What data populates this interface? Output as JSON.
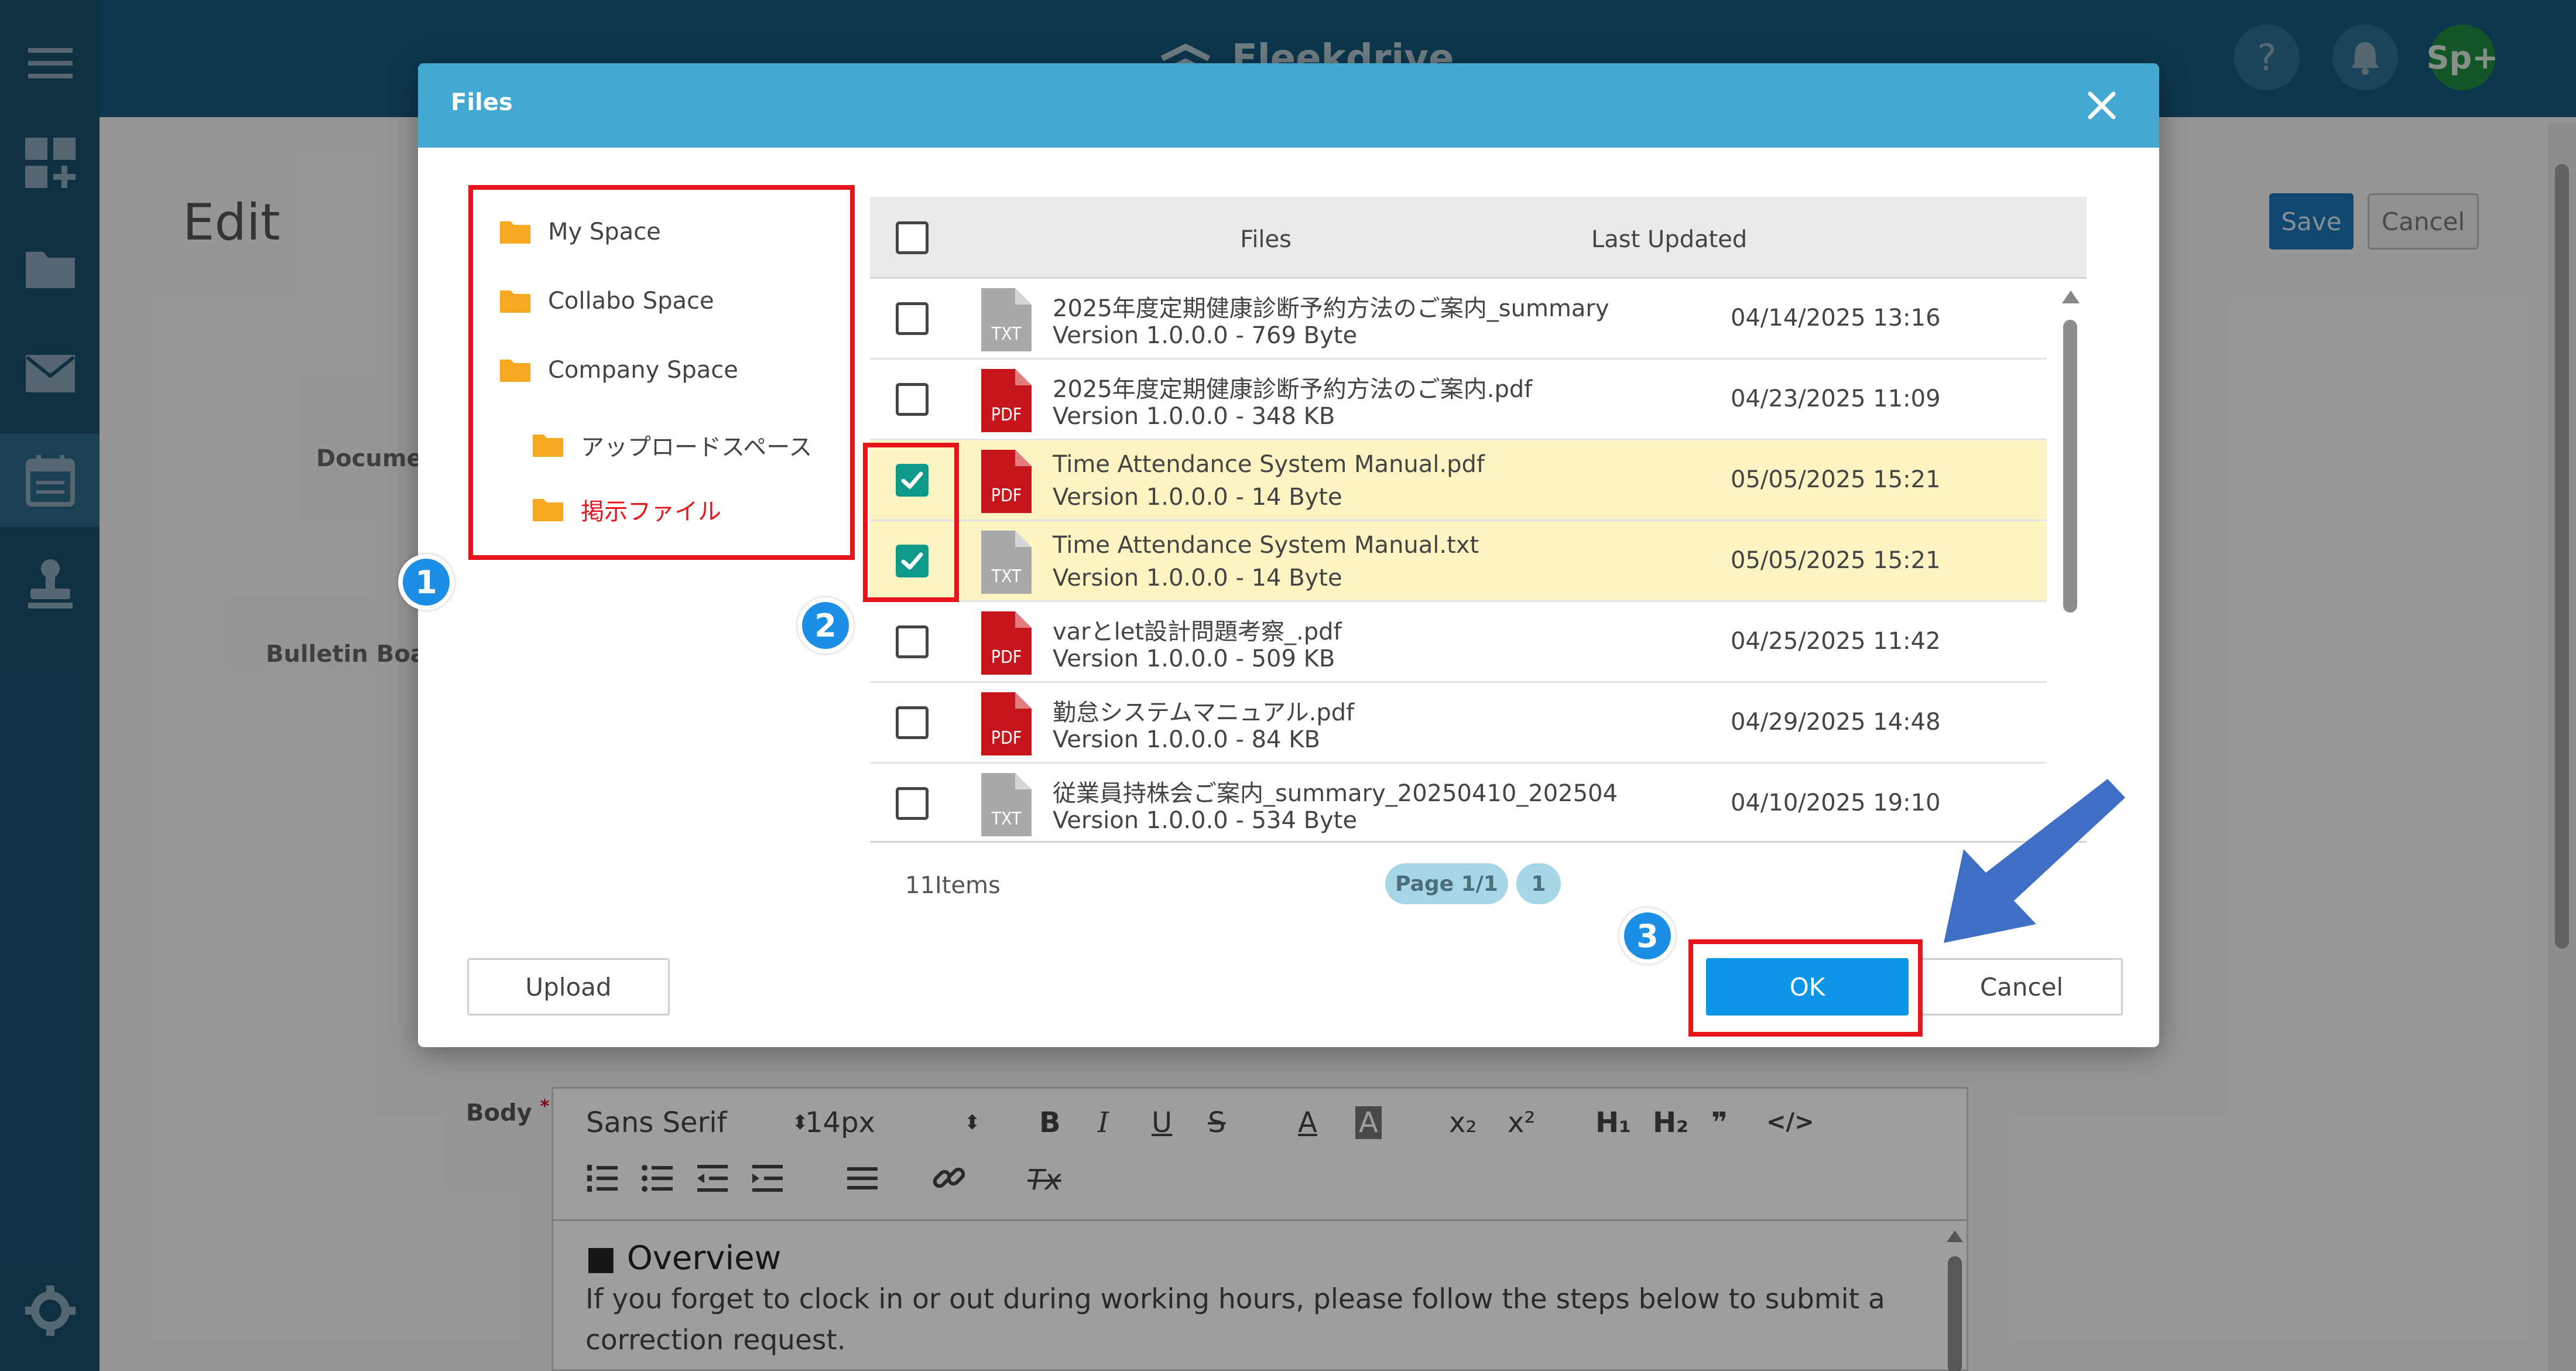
{
  "app": {
    "logo_text": "Fleekdrive",
    "help_glyph": "?",
    "avatar_text": "Sp+",
    "page_title": "Edit",
    "save_label": "Save",
    "cancel_label": "Cancel",
    "label_document": "Document",
    "label_bulletin": "Bulletin Board",
    "sidebar_icons": [
      "menu-icon",
      "dashboard-add-icon",
      "folder-icon",
      "mail-icon",
      "calendar-icon",
      "stamp-icon",
      "gear-icon"
    ]
  },
  "editor": {
    "body_label": "Body",
    "required_mark": "*",
    "font_family": "Sans Serif",
    "font_size": "14px",
    "toolbar_row1": [
      "B",
      "I",
      "U",
      "S",
      "A",
      "A",
      "x₂",
      "x²",
      "H₁",
      "H₂",
      "❞",
      "</>"
    ],
    "toolbar_row2": [
      "list-ordered-icon",
      "list-bullet-icon",
      "outdent-icon",
      "indent-icon",
      "align-icon",
      "link-icon",
      "clear-format-icon"
    ],
    "clear_format_glyph": "Tx",
    "content_heading": "■ Overview",
    "content_text": "If you forget to clock in or out during working hours, please follow the steps below to submit a correction request."
  },
  "dialog": {
    "title": "Files",
    "folders": [
      {
        "name": "My Space",
        "active": false
      },
      {
        "name": "Collabo Space",
        "active": false
      },
      {
        "name": "Company Space",
        "active": false
      },
      {
        "name": "アップロードスペース",
        "active": false
      },
      {
        "name": "掲示ファイル",
        "active": true
      }
    ],
    "table": {
      "col_files": "Files",
      "col_updated": "Last Updated",
      "rows": [
        {
          "type": "TXT",
          "name": "2025年度定期健康診断予約方法のご案内_summary",
          "version": "Version 1.0.0.0 - 769 Byte",
          "updated": "04/14/2025 13:16",
          "checked": false
        },
        {
          "type": "PDF",
          "name": "2025年度定期健康診断予約方法のご案内.pdf",
          "version": "Version 1.0.0.0 - 348 KB",
          "updated": "04/23/2025 11:09",
          "checked": false
        },
        {
          "type": "PDF",
          "name": "Time Attendance System Manual.pdf",
          "version": "Version 1.0.0.0 - 14 Byte",
          "updated": "05/05/2025 15:21",
          "checked": true
        },
        {
          "type": "TXT",
          "name": "Time Attendance System Manual.txt",
          "version": "Version 1.0.0.0 - 14 Byte",
          "updated": "05/05/2025 15:21",
          "checked": true
        },
        {
          "type": "PDF",
          "name": "varとlet設計問題考察_.pdf",
          "version": "Version 1.0.0.0 - 509 KB",
          "updated": "04/25/2025 11:42",
          "checked": false
        },
        {
          "type": "PDF",
          "name": "勤怠システムマニュアル.pdf",
          "version": "Version 1.0.0.0 - 84 KB",
          "updated": "04/29/2025 14:48",
          "checked": false
        },
        {
          "type": "TXT",
          "name": "従業員持株会ご案内_summary_20250410_202504",
          "version": "Version 1.0.0.0 - 534 Byte",
          "updated": "04/10/2025 19:10",
          "checked": false
        }
      ],
      "items_count": "11Items",
      "page_label": "Page 1/1",
      "page_number": "1"
    },
    "upload_label": "Upload",
    "ok_label": "OK",
    "cancel_label": "Cancel"
  },
  "annotations": {
    "step1": "1",
    "step2": "2",
    "step3": "3",
    "highlight_color": "#e8141b",
    "badge_color": "#1c8ee6",
    "arrow_color": "#3f6fc4"
  }
}
